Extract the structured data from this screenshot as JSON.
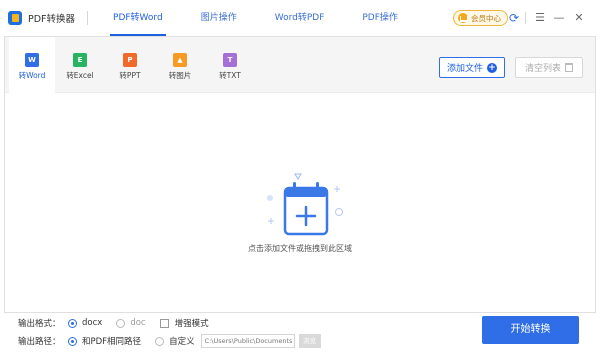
{
  "app": {
    "title": "PDF转换器"
  },
  "topnav": [
    {
      "label": "PDF转Word",
      "active": true
    },
    {
      "label": "图片操作"
    },
    {
      "label": "Word转PDF"
    },
    {
      "label": "PDF操作"
    }
  ],
  "titlebar": {
    "vip_label": "会员中心",
    "refresh_icon": "refresh-icon",
    "menu_icon": "menu-icon",
    "min_icon": "minimize-icon",
    "close_icon": "close-icon"
  },
  "formats": [
    {
      "label": "转Word",
      "badge": "W",
      "active": true
    },
    {
      "label": "转Excel",
      "badge": "E"
    },
    {
      "label": "转PPT",
      "badge": "P"
    },
    {
      "label": "转图片",
      "badge": "▲"
    },
    {
      "label": "转TXT",
      "badge": "T"
    }
  ],
  "toolbar": {
    "add_file_label": "添加文件",
    "clear_label": "清空列表"
  },
  "drop": {
    "hint": "点击添加文件或拖拽到此区域"
  },
  "options": {
    "format_label": "输出格式：",
    "docx": "docx",
    "doc": "doc",
    "enhanced": "增强模式",
    "path_label": "输出路径：",
    "same_path": "和PDF相同路径",
    "custom": "自定义",
    "path_value": "C:\\Users\\Public\\Documents",
    "browse": "浏览"
  },
  "start_label": "开始转换",
  "colors": {
    "accent": "#2f6ee6",
    "vip": "#f3a81a"
  }
}
